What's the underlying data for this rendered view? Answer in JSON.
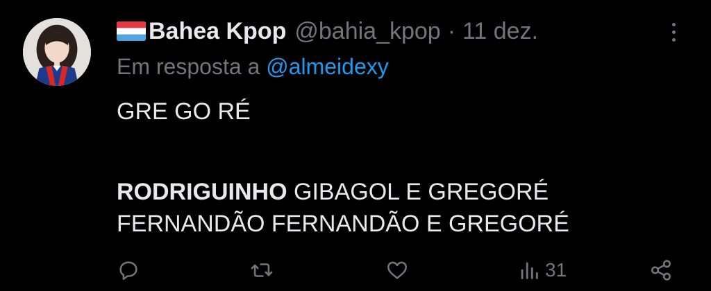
{
  "tweet": {
    "display_name": "Bahea Kpop",
    "handle": "@bahia_kpop",
    "separator": "·",
    "date": "11 dez.",
    "reply_prefix": "Em resposta a",
    "reply_to": "@almeidexy",
    "body": {
      "line1": "GRE GO RÉ",
      "line3_bold": "RODRIGUINHO",
      "line3_rest": " GIBAGOL E GREGORÉ",
      "line4": "FERNANDÃO FERNANDÃO E GREGORÉ"
    }
  },
  "actions": {
    "views_count": "31"
  },
  "colors": {
    "background": "#000000",
    "text": "#e7e9ea",
    "muted": "#71767b",
    "link": "#1d9bf0"
  },
  "icons": [
    "flag-icon",
    "more-options-icon",
    "reply-icon",
    "retweet-icon",
    "like-icon",
    "views-icon",
    "share-icon"
  ]
}
